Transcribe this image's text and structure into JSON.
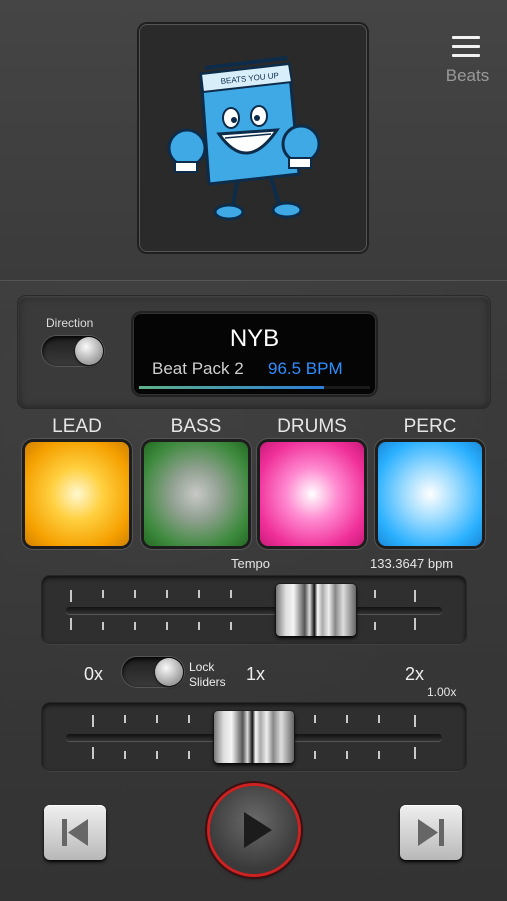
{
  "menu": {
    "label": "Beats",
    "icon": "hamburger-menu-icon"
  },
  "album_art": {
    "icon": "boxing-record-crate-mascot-icon",
    "crate_text": "BEATS YOU UP"
  },
  "direction": {
    "label": "Direction",
    "on": true
  },
  "display": {
    "title": "NYB",
    "pack": "Beat Pack 2",
    "bpm": "96.5 BPM",
    "progress": 0.8,
    "bpm_color": "#2f8fff"
  },
  "pads": [
    {
      "label": "LEAD",
      "color": "#f5a000"
    },
    {
      "label": "BASS",
      "color": "#3d8a3d"
    },
    {
      "label": "DRUMS",
      "color": "#f0309a"
    },
    {
      "label": "PERC",
      "color": "#2ab0ff"
    }
  ],
  "tempo": {
    "label": "Tempo",
    "value": "133.3647 bpm"
  },
  "multiplier": {
    "min": "0x",
    "mid": "1x",
    "max": "2x",
    "value": "1.00x",
    "lock_label_line1": "Lock",
    "lock_label_line2": "Sliders",
    "lock_on": true
  },
  "transport": {
    "prev_icon": "skip-back-icon",
    "play_icon": "play-icon",
    "next_icon": "skip-forward-icon",
    "accent": "#cc2222"
  }
}
